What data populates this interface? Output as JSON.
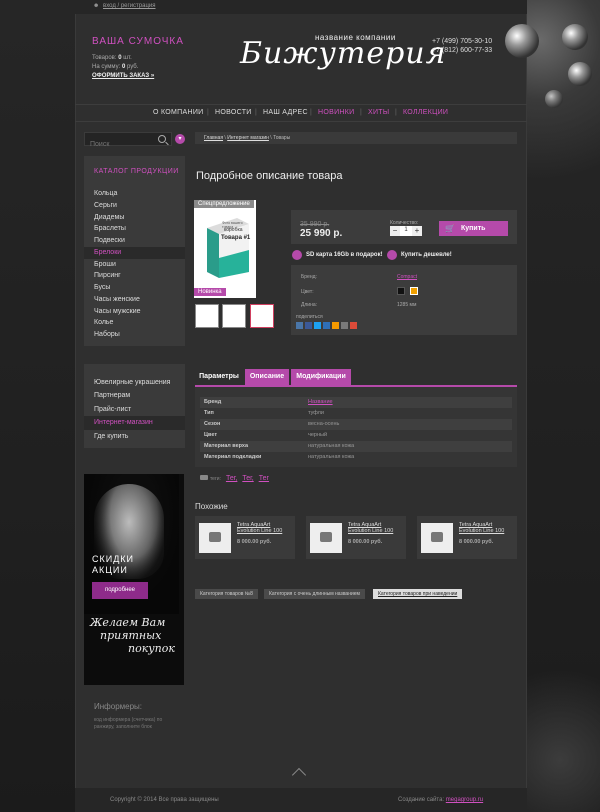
{
  "topbar": {
    "login": "вход / регистрация"
  },
  "bag": {
    "title": "ВАША СУМОЧКА",
    "items_label": "Товаров:",
    "items_count": "0",
    "items_unit": "шт.",
    "sum_label": "На сумму:",
    "sum_value": "0",
    "sum_unit": "руб.",
    "order": "ОФОРМИТЬ ЗАКАЗ »"
  },
  "logo": {
    "subtitle": "название компании",
    "name": "Бижутерия"
  },
  "phones": [
    "+7 (499) 705-30-10",
    "+7 (812) 600-77-33"
  ],
  "nav": {
    "items": [
      {
        "label": "О КОМПАНИИ",
        "color": "#dddddd"
      },
      {
        "label": "НОВОСТИ",
        "color": "#dddddd"
      },
      {
        "label": "НАШ АДРЕС",
        "color": "#dddddd"
      },
      {
        "label": "НОВИНКИ",
        "color": "#d050c0"
      },
      {
        "label": "ХИТЫ",
        "color": "#d050c0"
      },
      {
        "label": "КОЛЛЕКЦИИ",
        "color": "#d050c0"
      }
    ]
  },
  "search": {
    "placeholder": "Поиск"
  },
  "catalog": {
    "title": "КАТАЛОГ ПРОДУКЦИИ",
    "items": [
      "Кольца",
      "Серьги",
      "Диадемы",
      "Браслеты",
      "Подвески",
      "Брелоки",
      "Броши",
      "Пирсинг",
      "Бусы",
      "Часы женские",
      "Часы мужские",
      "Колье",
      "Наборы"
    ],
    "active": "Брелоки"
  },
  "info_menu": {
    "items": [
      "Ювелирные украшения",
      "Партнерам",
      "Прайс-лист",
      "Интернет-магазин",
      "Где купить"
    ],
    "active": "Интернет-магазин"
  },
  "promo": {
    "line1": "СКИДКИ",
    "line2": "АКЦИИ",
    "button": "подробнее",
    "hand1": "Желаем Вам",
    "hand2": "приятных",
    "hand3": "покупок"
  },
  "informers": {
    "title": "Информеры:",
    "text": "код информера (счетчика) по ранжиру, заполните блок"
  },
  "breadcrumbs": [
    "Главная",
    "Интернет магазин",
    "Товары"
  ],
  "product": {
    "title": "Подробное описание товара",
    "badge_special": "Спецпредложение",
    "badge_new": "Новинка",
    "box_text1": "Фото вашего товара",
    "box_text2": "коробка",
    "box_text3": "Товара #1",
    "old_price": "35 990 р.",
    "price": "25 990 р.",
    "qty_label": "Количество:",
    "qty_value": "1",
    "buy": "Купить",
    "gift": "SD карта 16Gb в подарок!",
    "cheaper": "Купить дешевле!",
    "attrs": [
      {
        "k": "Бренд:",
        "v": "Compact"
      },
      {
        "k": "Цвет:",
        "v": ""
      },
      {
        "k": "Длина:",
        "v": "1285 мм"
      }
    ],
    "colors": [
      "#111111",
      "#f0a000"
    ],
    "share": "поделиться"
  },
  "tabs": [
    "Параметры",
    "Описание",
    "Модификации"
  ],
  "params": [
    {
      "k": "Бренд",
      "v": "Название"
    },
    {
      "k": "Тип",
      "v": "туфли"
    },
    {
      "k": "Сезон",
      "v": "весна-осень"
    },
    {
      "k": "Цвет",
      "v": "черный"
    },
    {
      "k": "Материал верха",
      "v": "натуральная кожа"
    },
    {
      "k": "Материал подкладки",
      "v": "натуральная кожа"
    }
  ],
  "tags": {
    "label": "теги:",
    "items": [
      "Тег,",
      "Тег,",
      "Тег"
    ]
  },
  "similar": {
    "title": "Похожие",
    "items": [
      {
        "name": "Tetra AquaArt Evolution Line 100",
        "price": "8 000.00 руб."
      },
      {
        "name": "Tetra AquaArt Evolution Line 100",
        "price": "8 000.00 руб."
      },
      {
        "name": "Tetra AquaArt Evolution Line 100",
        "price": "8 000.00 руб."
      }
    ]
  },
  "category_tags": [
    "Категория товаров №8",
    "Категория с очень длинным названием",
    "Категория товаров при наведении"
  ],
  "footer": {
    "copyright": "Copyright © 2014 Все права защищены",
    "made": "Создание сайта:",
    "maker": "megagroup.ru"
  }
}
